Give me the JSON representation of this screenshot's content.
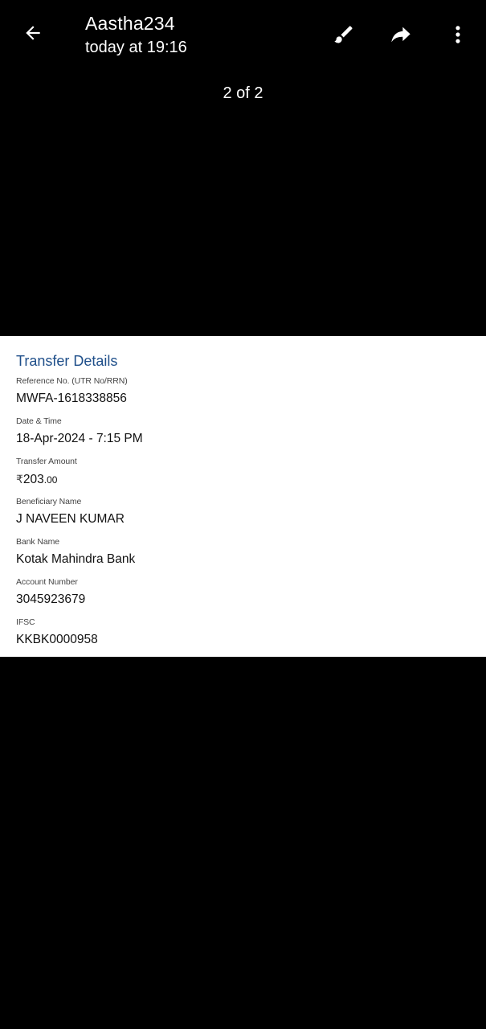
{
  "header": {
    "sender": "Aastha234",
    "timestamp": "today at 19:16",
    "icons": {
      "back": "arrow-left-icon",
      "edit": "paintbrush-icon",
      "forward": "forward-arrow-icon",
      "more": "more-vertical-icon"
    }
  },
  "counter": "2 of 2",
  "receipt": {
    "title": "Transfer Details",
    "fields": [
      {
        "label": "Reference No. (UTR No/RRN)",
        "value": "MWFA-1618338856"
      },
      {
        "label": "Date & Time",
        "value": "18-Apr-2024 - 7:15 PM"
      },
      {
        "label": "Transfer Amount",
        "currency": "₹",
        "amount": "203",
        "decimals": ".00"
      },
      {
        "label": "Beneficiary Name",
        "value": "J NAVEEN KUMAR"
      },
      {
        "label": "Bank Name",
        "value": "Kotak Mahindra Bank"
      },
      {
        "label": "Account Number",
        "value": "3045923679"
      },
      {
        "label": "IFSC",
        "value": "KKBK0000958"
      }
    ]
  },
  "colors": {
    "background": "#000000",
    "receipt_bg": "#ffffff",
    "title_blue": "#1f4f8a"
  }
}
